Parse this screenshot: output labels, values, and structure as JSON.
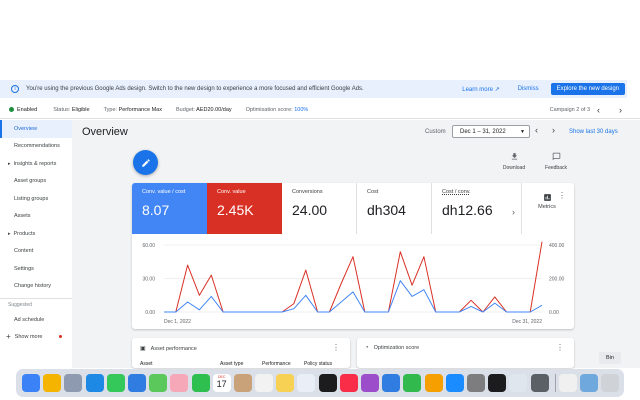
{
  "banner": {
    "message": "You're using the previous Google Ads design. Switch to the new design to experience a more focused and efficient Google Ads.",
    "learn_more": "Learn more",
    "dismiss": "Dismiss",
    "explore": "Explore the new design"
  },
  "statusbar": {
    "enabled": "Enabled",
    "status_label": "Status:",
    "status_value": "Eligible",
    "type_label": "Type:",
    "type_value": "Performance Max",
    "budget_label": "Budget:",
    "budget_value": "AED20.00/day",
    "opt_label": "Optimisation score:",
    "opt_value": "100%",
    "campaign_pos": "Campaign 2 of 3"
  },
  "sidebar": {
    "items": [
      {
        "label": "Overview",
        "active": true
      },
      {
        "label": "Recommendations"
      },
      {
        "label": "Insights & reports",
        "expandable": true
      },
      {
        "label": "Asset groups"
      },
      {
        "label": "Listing groups"
      },
      {
        "label": "Assets"
      },
      {
        "label": "Products",
        "expandable": true
      },
      {
        "label": "Content"
      },
      {
        "label": "Settings"
      },
      {
        "label": "Change history"
      }
    ],
    "suggested_label": "Suggested",
    "suggested_items": [
      {
        "label": "Ad schedule"
      }
    ],
    "show_more": "Show more"
  },
  "header": {
    "title": "Overview",
    "custom": "Custom",
    "date_range": "Dec 1 – 31, 2022",
    "show_last": "Show last 30 days"
  },
  "toolbar": {
    "download": "Download",
    "feedback": "Feedback"
  },
  "tiles": [
    {
      "label": "Conv. value / cost",
      "value": "8.07",
      "color": "#4285f4"
    },
    {
      "label": "Conv. value",
      "value": "2.45K",
      "color": "#d93025"
    },
    {
      "label": "Conversions",
      "value": "24.00"
    },
    {
      "label": "Cost",
      "value": "dh304"
    },
    {
      "label": "Cost / conv.",
      "value": "dh12.66"
    }
  ],
  "metrics_label": "Metrics",
  "chart_data": {
    "type": "line",
    "x_labels": [
      "Dec 1, 2022",
      "Dec 31, 2022"
    ],
    "left_axis_ticks": [
      "60.00",
      "30.00",
      "0.00"
    ],
    "right_axis_ticks": [
      "400.00",
      "200.00",
      "0.00"
    ],
    "left_ylim": [
      0,
      60
    ],
    "right_ylim": [
      0,
      400
    ],
    "grid": true,
    "series": [
      {
        "color": "#d93025",
        "axis": "right",
        "values": [
          0,
          0,
          280,
          100,
          220,
          0,
          0,
          0,
          0,
          0,
          0,
          50,
          250,
          0,
          0,
          170,
          330,
          0,
          0,
          0,
          360,
          160,
          330,
          0,
          0,
          0,
          70,
          0,
          90,
          0,
          0,
          0,
          420
        ]
      },
      {
        "color": "#4285f4",
        "axis": "left",
        "values": [
          0,
          0,
          9,
          2,
          14,
          0,
          0,
          0,
          0,
          0,
          0,
          3,
          15,
          0,
          0,
          9,
          18,
          0,
          0,
          0,
          28,
          14,
          20,
          0,
          0,
          0,
          5,
          0,
          8,
          0,
          0,
          0,
          6
        ]
      }
    ]
  },
  "panels": {
    "asset_performance": "Asset performance",
    "asset_sub": [
      "Asset",
      "Asset type",
      "Performance",
      "Policy status"
    ],
    "optimization_score": "Optimization score"
  },
  "bin_label": "Bin",
  "dock": {
    "calendar_month": "DEC",
    "calendar_day": "17",
    "apps": [
      {
        "name": "finder-icon",
        "color": "#3b82f6"
      },
      {
        "name": "chrome-icon",
        "color": "#f4b400"
      },
      {
        "name": "launchpad-icon",
        "color": "#8e9aaf"
      },
      {
        "name": "safari-icon",
        "color": "#1e88e5"
      },
      {
        "name": "messages-icon",
        "color": "#34c759"
      },
      {
        "name": "mail-icon",
        "color": "#2f7de1"
      },
      {
        "name": "maps-icon",
        "color": "#5ac85a"
      },
      {
        "name": "photos-icon",
        "color": "#f7a8b8"
      },
      {
        "name": "facetime-icon",
        "color": "#2fbf4f"
      },
      {
        "name": "calendar-icon",
        "color": "#ffffff"
      },
      {
        "name": "contacts-icon",
        "color": "#c9a27a"
      },
      {
        "name": "reminders-icon",
        "color": "#f2f2f2"
      },
      {
        "name": "notes-icon",
        "color": "#f7d154"
      },
      {
        "name": "freeform-icon",
        "color": "#e9eef7"
      },
      {
        "name": "appletv-icon",
        "color": "#1c1c1e"
      },
      {
        "name": "music-icon",
        "color": "#fa2d48"
      },
      {
        "name": "podcasts-icon",
        "color": "#9b4dca"
      },
      {
        "name": "keynote-icon",
        "color": "#2f7de1"
      },
      {
        "name": "numbers-icon",
        "color": "#31b94d"
      },
      {
        "name": "pages-icon",
        "color": "#f59f00"
      },
      {
        "name": "appstore-icon",
        "color": "#1a8cff"
      },
      {
        "name": "settings-icon",
        "color": "#7d7d80"
      },
      {
        "name": "clock-icon",
        "color": "#1c1c1e"
      },
      {
        "name": "preview-icon",
        "color": "#dfe6ee"
      },
      {
        "name": "screenshot-icon",
        "color": "#5b5f66"
      },
      {
        "name": "textedit-icon",
        "color": "#f0f0f0"
      },
      {
        "name": "downloads-folder-icon",
        "color": "#6fa8dc"
      },
      {
        "name": "trash-icon",
        "color": "#cfd3d8"
      }
    ]
  }
}
